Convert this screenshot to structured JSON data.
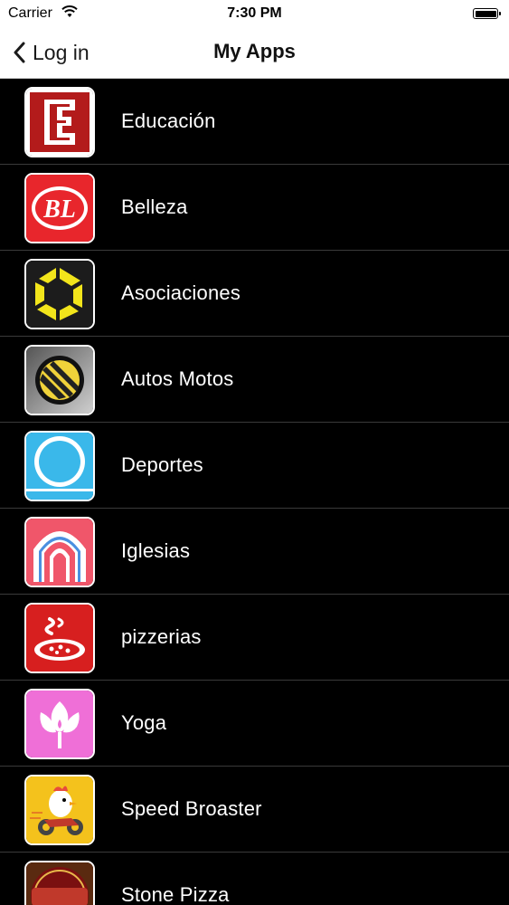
{
  "status_bar": {
    "carrier": "Carrier",
    "time": "7:30 PM"
  },
  "nav": {
    "back_label": "Log in",
    "title": "My Apps"
  },
  "apps": [
    {
      "label": "Educación",
      "icon": "education-icon",
      "color": "#b31b1b"
    },
    {
      "label": "Belleza",
      "icon": "beauty-icon",
      "color": "#e8262c"
    },
    {
      "label": "Asociaciones",
      "icon": "associations-icon",
      "color": "#f2e51b"
    },
    {
      "label": "Autos Motos",
      "icon": "autos-motos-icon",
      "color": "#f0d23a"
    },
    {
      "label": "Deportes",
      "icon": "sports-icon",
      "color": "#3ab8ea"
    },
    {
      "label": "Iglesias",
      "icon": "church-icon",
      "color": "#f0566a"
    },
    {
      "label": "pizzerias",
      "icon": "pizza-icon",
      "color": "#d71f1f"
    },
    {
      "label": "Yoga",
      "icon": "yoga-icon",
      "color": "#ef6fd7"
    },
    {
      "label": "Speed Broaster",
      "icon": "speed-broaster-icon",
      "color": "#f4c21c"
    },
    {
      "label": "Stone Pizza",
      "icon": "stone-pizza-icon",
      "color": "#7a1010"
    }
  ]
}
